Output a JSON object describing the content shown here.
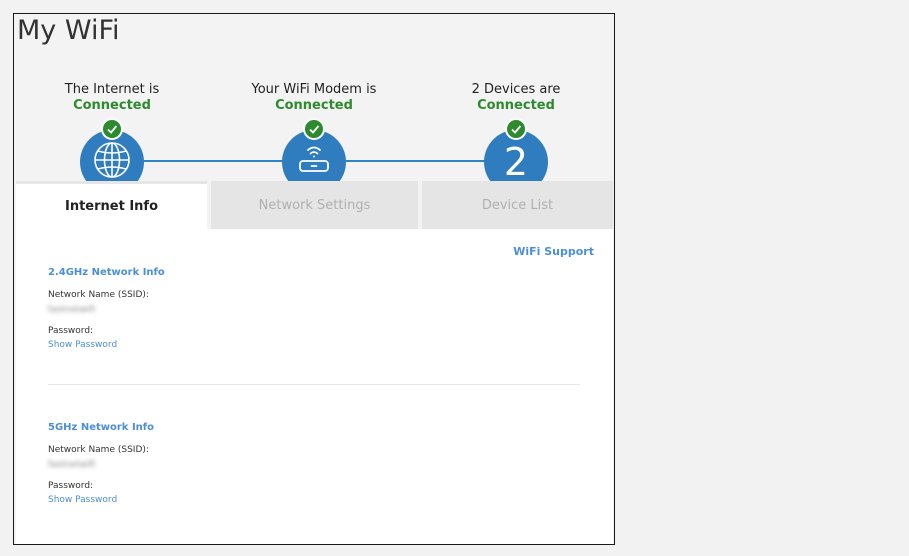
{
  "page_title": "My WiFi",
  "steps": [
    {
      "label": "The Internet is",
      "status": "Connected",
      "icon": "globe-icon"
    },
    {
      "label": "Your WiFi Modem is",
      "status": "Connected",
      "icon": "modem-icon"
    },
    {
      "label": "2  Devices are",
      "status": "Connected",
      "number": "2"
    }
  ],
  "colors": {
    "status": "#2e8a2e",
    "accent": "#2f7dbe",
    "link": "#4b8fd6"
  },
  "tabs": [
    {
      "label": "Internet Info",
      "active": true
    },
    {
      "label": "Network Settings",
      "active": false
    },
    {
      "label": "Device List",
      "active": false
    }
  ],
  "support_link": "WiFi Support",
  "networks": [
    {
      "heading": "2.4GHz Network Info",
      "ssid_label": "Network Name (SSID):",
      "ssid_value": "fastnetwifi",
      "password_label": "Password:",
      "show_password": "Show Password"
    },
    {
      "heading": "5GHz Network Info",
      "ssid_label": "Network Name (SSID):",
      "ssid_value": "fastnetwifi",
      "password_label": "Password:",
      "show_password": "Show Password"
    }
  ]
}
